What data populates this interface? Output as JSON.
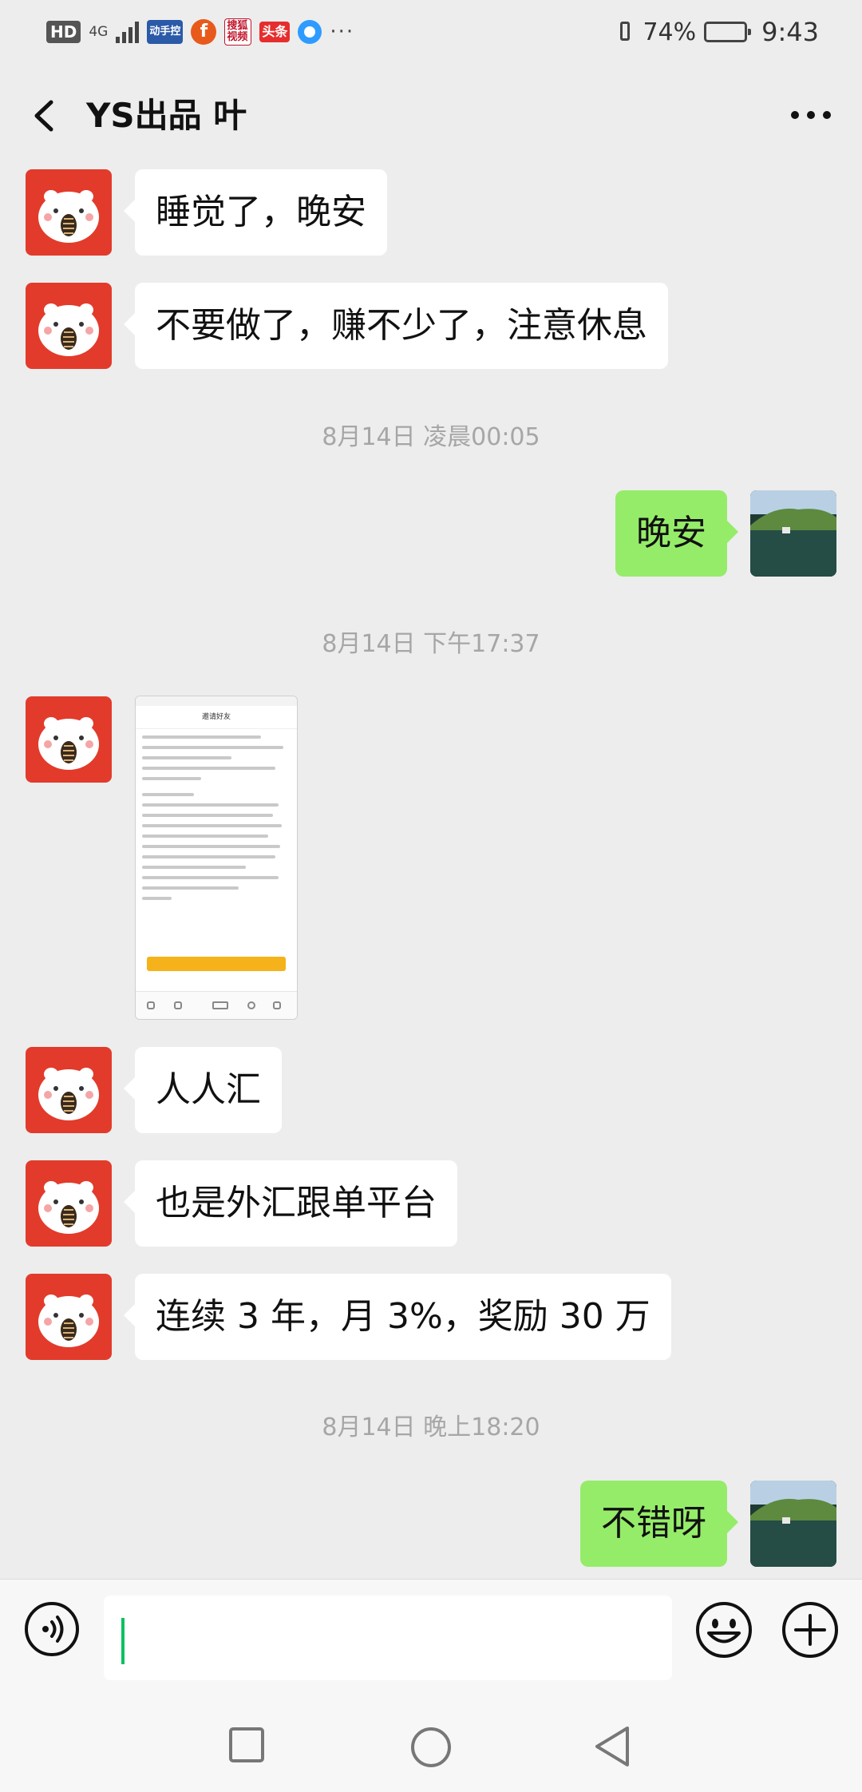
{
  "status_bar": {
    "hd_label": "HD",
    "network_label": "4G",
    "app_zhifubao": "动手控",
    "app_sohu": "搜狐视频",
    "app_toutiao": "头条",
    "more_dots": "···",
    "battery_percent": "74%",
    "battery_level": 0.74,
    "time": "9:43"
  },
  "header": {
    "title": "YS出品 叶"
  },
  "messages": [
    {
      "side": "left",
      "text": "睡觉了，晚安"
    },
    {
      "side": "left",
      "text": "不要做了，赚不少了，注意休息"
    },
    {
      "type": "time",
      "text": "8月14日 凌晨00:05"
    },
    {
      "side": "right",
      "text": "晚安"
    },
    {
      "type": "time",
      "text": "8月14日 下午17:37"
    },
    {
      "side": "left",
      "type": "image",
      "title": "邀请好友"
    },
    {
      "side": "left",
      "text": "人人汇"
    },
    {
      "side": "left",
      "text": "也是外汇跟单平台"
    },
    {
      "side": "left",
      "text": "连续 3 年，月 3%，奖励 30 万"
    },
    {
      "type": "time",
      "text": "8月14日 晚上18:20"
    },
    {
      "side": "right",
      "text": "不错呀"
    }
  ],
  "input": {
    "value": ""
  },
  "colors": {
    "background": "#ededed",
    "bubble_self": "#95ec69",
    "bubble_other": "#ffffff",
    "accent_cursor": "#07c160",
    "avatar_other_bg": "#e23b2b"
  },
  "icons": {
    "back": "chevron-left-icon",
    "more": "more-dots-icon",
    "voice": "voice-icon",
    "emoji": "emoji-icon",
    "plus": "plus-icon"
  }
}
